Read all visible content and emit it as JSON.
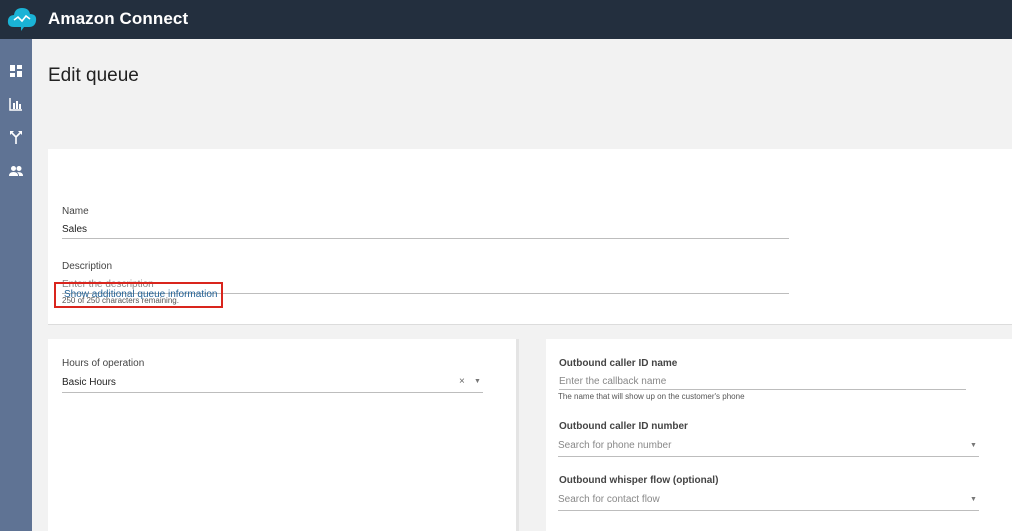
{
  "app": {
    "brand_name": "Amazon Connect"
  },
  "sidebar": {
    "items": [
      {
        "icon": "dashboard-icon"
      },
      {
        "icon": "metrics-chart-icon"
      },
      {
        "icon": "routing-icon"
      },
      {
        "icon": "users-icon"
      }
    ]
  },
  "page": {
    "title": "Edit queue"
  },
  "form": {
    "name_label": "Name",
    "name_value": "Sales",
    "description_label": "Description",
    "description_placeholder": "Enter the description",
    "description_remaining": "250 of 250 characters remaining.",
    "show_more_link": "Show additional queue information"
  },
  "hours": {
    "label": "Hours of operation",
    "value": "Basic Hours",
    "clear_icon": "×",
    "dropdown_icon": "▼"
  },
  "outbound": {
    "caller_name_label": "Outbound caller ID name",
    "caller_name_placeholder": "Enter the callback name",
    "caller_name_hint": "The name that will show up on the customer's phone",
    "caller_number_label": "Outbound caller ID number",
    "caller_number_placeholder": "Search for phone number",
    "whisper_label": "Outbound whisper flow (optional)",
    "whisper_placeholder": "Search for contact flow",
    "dropdown_icon": "▼"
  },
  "colors": {
    "topbar": "#232f3e",
    "sidebar": "#5f7394",
    "logo": "#1ab3d6",
    "link": "#1f5f94",
    "highlight_border": "#d9251d"
  }
}
